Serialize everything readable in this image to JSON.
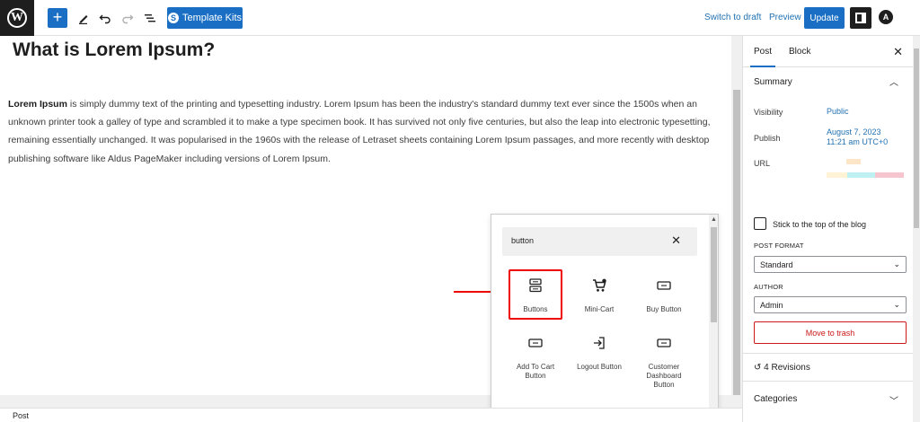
{
  "toolbar": {
    "template_kits_label": "Template Kits",
    "switch_to_draft": "Switch to draft",
    "preview": "Preview",
    "update": "Update"
  },
  "editor": {
    "title": "What is Lorem Ipsum?",
    "paragraph_bold": "Lorem Ipsum",
    "paragraph_rest": " is simply dummy text of the printing and typesetting industry. Lorem Ipsum has been the industry's standard dummy text ever since the 1500s when an unknown printer took a galley of type and scrambled it to make a type specimen book. It has survived not only five centuries, but also the leap into electronic typesetting, remaining essentially unchanged. It was popularised in the 1960s with the release of Letraset sheets containing Lorem Ipsum passages, and more recently with desktop publishing software like Aldus PageMaker including versions of Lorem Ipsum."
  },
  "inserter": {
    "search_value": "button",
    "blocks": [
      {
        "label": "Buttons",
        "icon": "buttons-icon"
      },
      {
        "label": "Mini-Cart",
        "icon": "cart-icon"
      },
      {
        "label": "Buy Button",
        "icon": "button-icon"
      },
      {
        "label": "Add To Cart Button",
        "icon": "button-icon"
      },
      {
        "label": "Logout Button",
        "icon": "logout-icon"
      },
      {
        "label": "Customer Dashboard Button",
        "icon": "button-icon"
      }
    ]
  },
  "sidebar": {
    "tabs": [
      "Post",
      "Block"
    ],
    "summary_title": "Summary",
    "visibility_label": "Visibility",
    "visibility_value": "Public",
    "publish_label": "Publish",
    "publish_date": "August 7, 2023",
    "publish_time": "11:21 am UTC+0",
    "url_label": "URL",
    "sticky_label": "Stick to the top of the blog",
    "post_format_label": "POST FORMAT",
    "post_format_value": "Standard",
    "author_label": "AUTHOR",
    "author_value": "Admin",
    "trash_label": "Move to trash",
    "revisions_label": "4 Revisions",
    "categories_label": "Categories"
  },
  "footer": {
    "breadcrumb": "Post"
  },
  "colors": {
    "accent": "#1a6fc4",
    "annotation": "#e00000",
    "danger": "#cc1818"
  }
}
